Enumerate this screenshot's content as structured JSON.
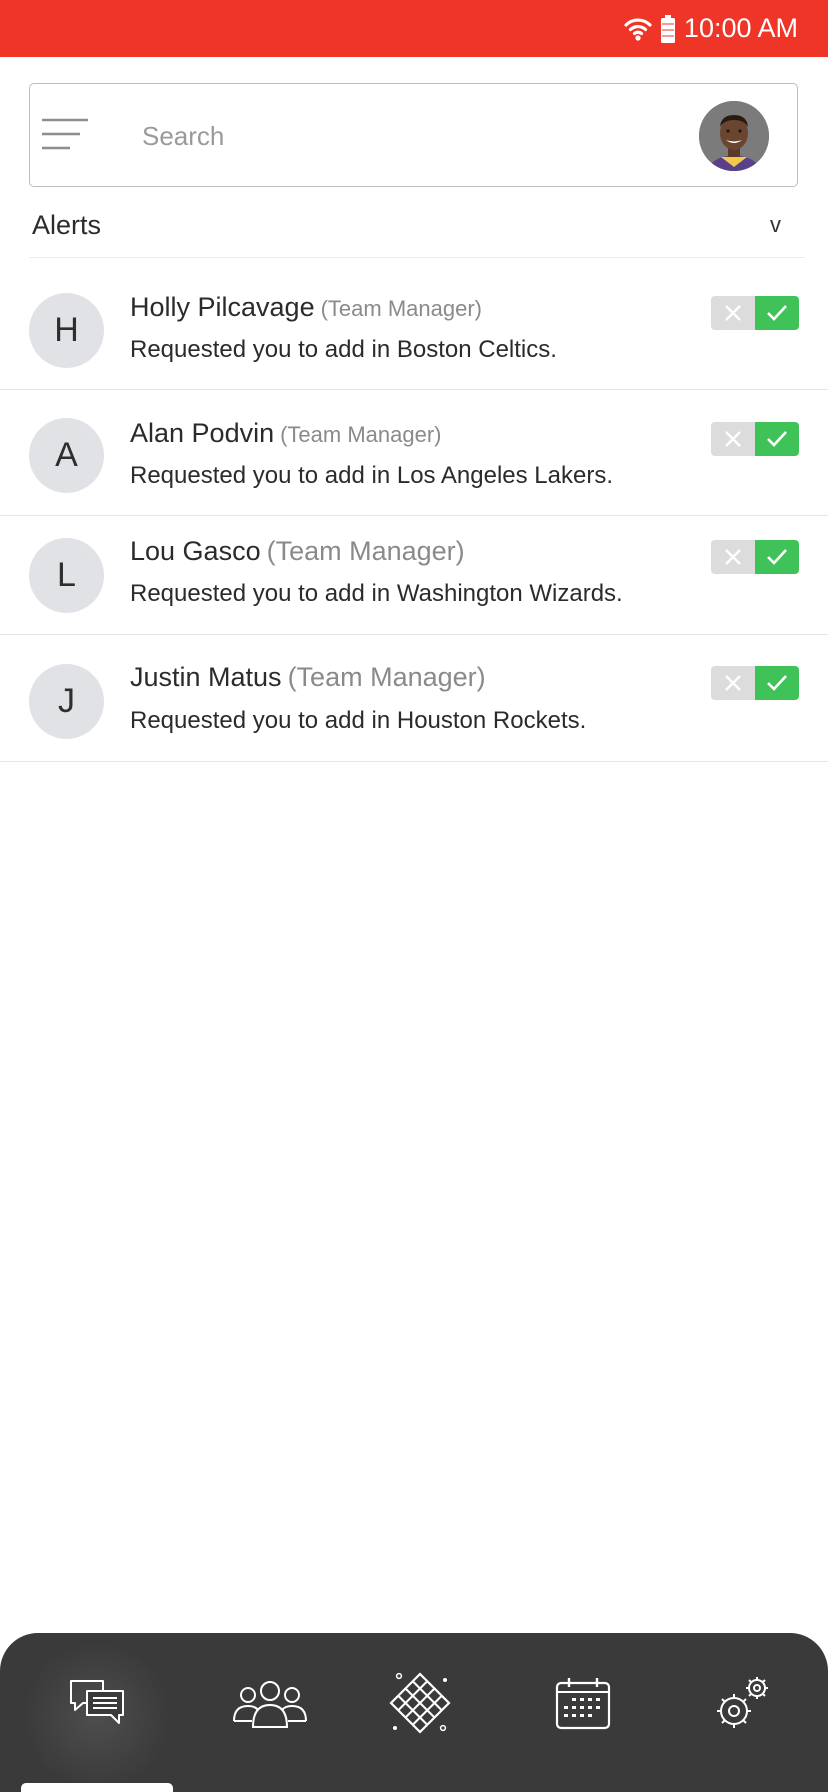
{
  "status_bar": {
    "time": "10:00 AM",
    "wifi_icon": "wifi-icon",
    "battery_icon": "battery-icon",
    "background_color": "#ee3527"
  },
  "search": {
    "placeholder": "Search",
    "value": "",
    "menu_icon": "menu-icon",
    "avatar": "user-avatar"
  },
  "alerts": {
    "title": "Alerts",
    "toggle_glyph": "v",
    "items": [
      {
        "initial": "H",
        "name": "Holly Pilcavage",
        "role": "(Team Manager)",
        "message": "Requested you to add in Boston Celtics."
      },
      {
        "initial": "A",
        "name": "Alan Podvin",
        "role": "(Team Manager)",
        "message": "Requested you to add in Los Angeles Lakers."
      },
      {
        "initial": "L",
        "name": "Lou Gasco",
        "role": "(Team Manager)",
        "message": "Requested you to add in Washington Wizards."
      },
      {
        "initial": "J",
        "name": "Justin Matus",
        "role": "(Team Manager)",
        "message": "Requested you to add in Houston Rockets."
      }
    ],
    "reject_icon": "close-icon",
    "accept_icon": "check-icon",
    "accept_color": "#3fc257",
    "reject_color": "#dcdcdc"
  },
  "bottom_nav": {
    "items": [
      {
        "icon": "chat-icon",
        "active": true
      },
      {
        "icon": "team-icon",
        "active": false
      },
      {
        "icon": "court-icon",
        "active": false
      },
      {
        "icon": "calendar-icon",
        "active": false
      },
      {
        "icon": "settings-icon",
        "active": false
      }
    ],
    "background_color": "#3a3a3a"
  }
}
